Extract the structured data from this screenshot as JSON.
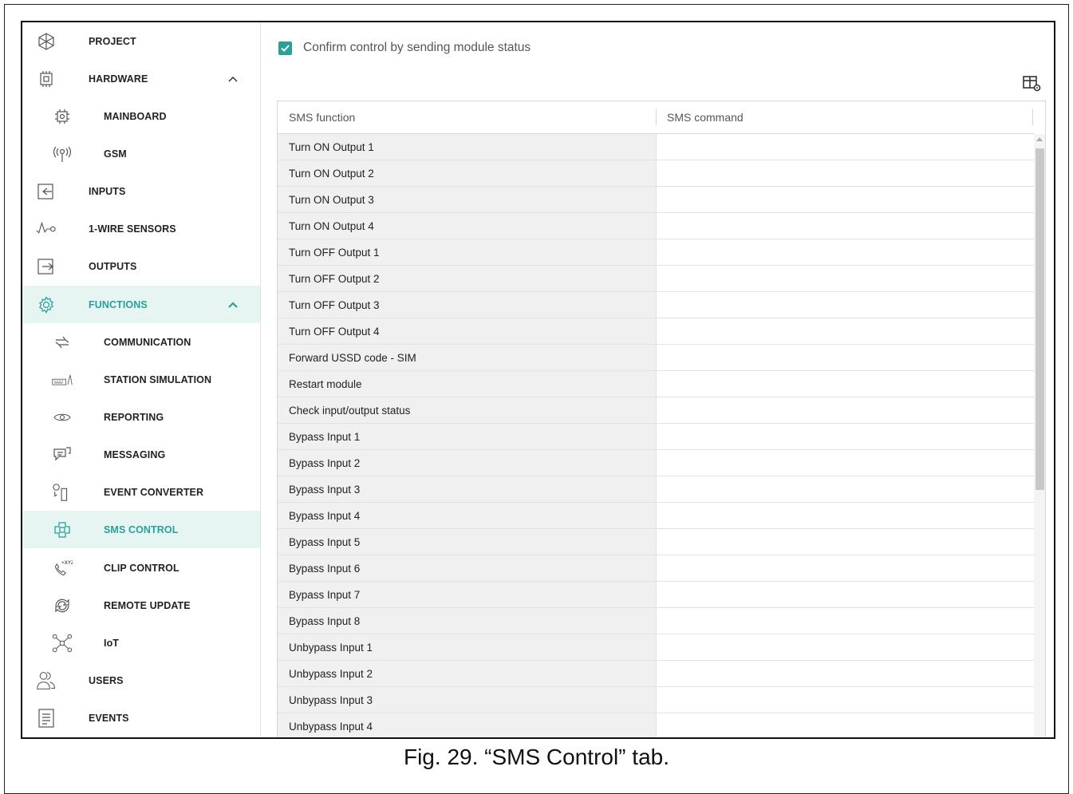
{
  "sidebar": {
    "items": [
      {
        "label": "PROJECT",
        "icon": "snowflake-icon",
        "level": "top"
      },
      {
        "label": "HARDWARE",
        "icon": "chip-icon",
        "level": "top",
        "expanded": true
      },
      {
        "label": "MAINBOARD",
        "icon": "mainboard-icon",
        "level": "sub"
      },
      {
        "label": "GSM",
        "icon": "antenna-icon",
        "level": "sub"
      },
      {
        "label": "INPUTS",
        "icon": "input-icon",
        "level": "top"
      },
      {
        "label": "1-WIRE SENSORS",
        "icon": "sensor-icon",
        "level": "top"
      },
      {
        "label": "OUTPUTS",
        "icon": "output-icon",
        "level": "top"
      },
      {
        "label": "FUNCTIONS",
        "icon": "gear-icon",
        "level": "top",
        "expanded": true,
        "active": true
      },
      {
        "label": "COMMUNICATION",
        "icon": "arrows-icon",
        "level": "sub"
      },
      {
        "label": "STATION SIMULATION",
        "icon": "keyboard-icon",
        "level": "sub"
      },
      {
        "label": "REPORTING",
        "icon": "eye-icon",
        "level": "sub"
      },
      {
        "label": "MESSAGING",
        "icon": "chat-icon",
        "level": "sub"
      },
      {
        "label": "EVENT CONVERTER",
        "icon": "converter-icon",
        "level": "sub"
      },
      {
        "label": "SMS CONTROL",
        "icon": "sms-control-icon",
        "level": "sub",
        "active": true
      },
      {
        "label": "CLIP CONTROL",
        "icon": "phone-icon",
        "level": "sub"
      },
      {
        "label": "REMOTE UPDATE",
        "icon": "refresh-icon",
        "level": "sub"
      },
      {
        "label": "IoT",
        "icon": "network-icon",
        "level": "sub"
      },
      {
        "label": "USERS",
        "icon": "users-icon",
        "level": "top"
      },
      {
        "label": "EVENTS",
        "icon": "document-icon",
        "level": "top"
      }
    ]
  },
  "main": {
    "confirm_label": "Confirm control by sending module status",
    "confirm_checked": true,
    "table": {
      "columns": [
        "SMS function",
        "SMS command"
      ],
      "rows": [
        "Turn ON Output 1",
        "Turn ON Output 2",
        "Turn ON Output 3",
        "Turn ON Output 4",
        "Turn OFF Output 1",
        "Turn OFF Output 2",
        "Turn OFF Output 3",
        "Turn OFF Output 4",
        "Forward USSD code - SIM",
        "Restart module",
        "Check input/output status",
        "Bypass Input 1",
        "Bypass Input 2",
        "Bypass Input 3",
        "Bypass Input 4",
        "Bypass Input 5",
        "Bypass Input 6",
        "Bypass Input 7",
        "Bypass Input 8",
        "Unbypass Input 1",
        "Unbypass Input 2",
        "Unbypass Input 3",
        "Unbypass Input 4"
      ]
    }
  },
  "caption": "Fig. 29. “SMS Control” tab.",
  "colors": {
    "accent": "#2aa198",
    "active_bg": "#e6f4f2",
    "function_cell_bg": "#f0f0f0"
  }
}
